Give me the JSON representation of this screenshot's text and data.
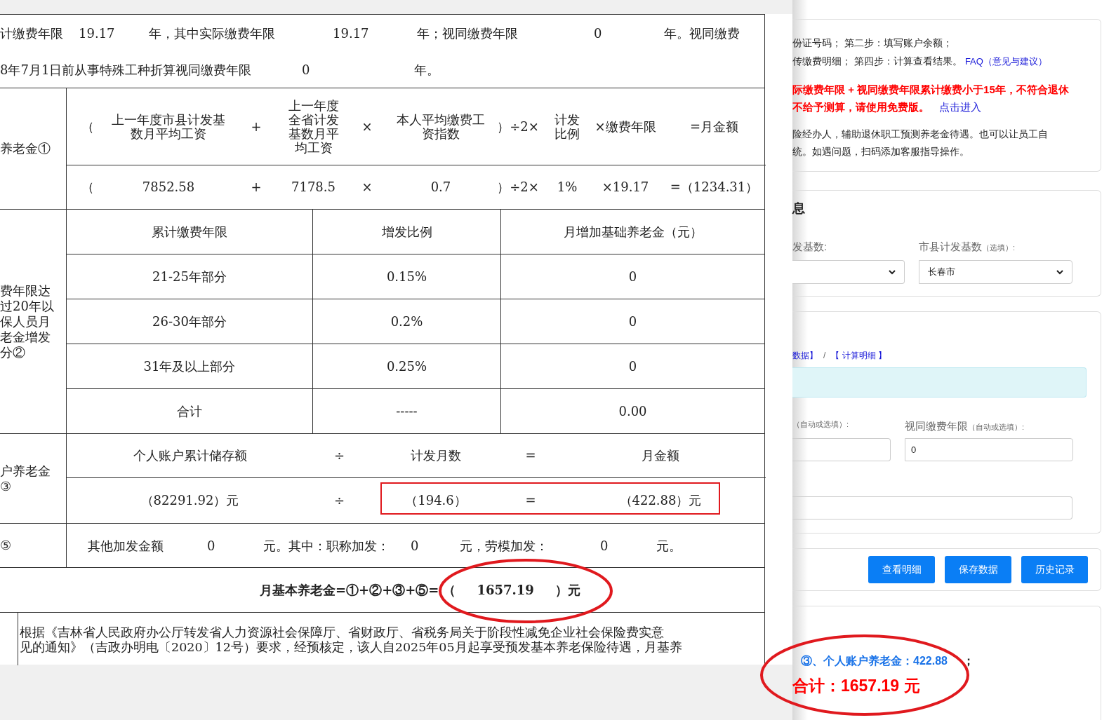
{
  "report": {
    "intro_lines": [
      [
        "计缴费年限",
        "19.17",
        "年，其中实际缴费年限",
        "19.17",
        "年；视同缴费年限",
        "0",
        "年。视同缴费"
      ],
      [
        "8年7月1日前从事特殊工种折算视同缴费年限",
        "0",
        "年。"
      ]
    ],
    "basic_pension": {
      "label": [
        "养老金①"
      ],
      "header": [
        "（",
        "上一年度市县计发基数月平均工资",
        "+",
        "上一年度全省计发基数月平均工资",
        "×",
        "本人平均缴费工资指数",
        "）÷2×",
        "计发比例",
        "×缴费年限",
        "=月金额"
      ],
      "values": [
        "（",
        "7852.58",
        "+",
        "7178.5",
        "×",
        "0.7",
        "）÷2×",
        "1%",
        "×19.17",
        "=（1234.31）"
      ]
    },
    "bonus_pension": {
      "label": [
        "费年限达",
        "过20年以",
        "保人员月",
        "老金增发",
        "分②"
      ],
      "columns": [
        "累计缴费年限",
        "增发比例",
        "月增加基础养老金（元）"
      ],
      "rows": [
        [
          "21-25年部分",
          "0.15%",
          "0"
        ],
        [
          "26-30年部分",
          "0.2%",
          "0"
        ],
        [
          "31年及以上部分",
          "0.25%",
          "0"
        ],
        [
          "合计",
          "-----",
          "0.00"
        ]
      ]
    },
    "account_pension": {
      "label": [
        "户养老金",
        "③"
      ],
      "header": [
        "个人账户累计储存额",
        "÷",
        "计发月数",
        "=",
        "月金额"
      ],
      "values": [
        "（82291.92）元",
        "÷",
        "（194.6）",
        "=",
        "（422.88）元"
      ]
    },
    "other_pension": {
      "label": [
        "⑤"
      ],
      "parts": [
        "其他加发金额",
        "0",
        "元。其中：职称加发：",
        "0",
        "元，劳模加发：",
        "0",
        "元。"
      ]
    },
    "total": {
      "formula": "月基本养老金=①+②+③+⑤=",
      "open": "（",
      "value": "1657.19",
      "close": "）元"
    },
    "notice_lines": [
      "根据《吉林省人民政府办公厅转发省人力资源社会保障厅、省财政厅、省税务局关于阶段性减免企业社会保险费实意",
      "见的通知》（吉政办明电〔2020〕12号）要求，经预核定，该人自2025年05月起享受预发基本养老保险待遇，月基养"
    ]
  },
  "steps_card": {
    "step_lines": [
      "份证号码； 第二步：填写账户余额；",
      "传缴费明细； 第四步：计算查看结果。"
    ],
    "faq_link": "FAQ（意见与建议）",
    "warning_lines": [
      "际缴费年限 + 视同缴费年限累计缴费小于15年，不符合退休",
      "不给予测算，请使用免费版。"
    ],
    "free_link": "点击进入",
    "intro_lines": [
      "险经办人，辅助退休职工预测养老金待遇。也可以让员工自",
      "统。如遇问题，扫码添加客服指导操作。"
    ]
  },
  "info_card": {
    "heading": "息",
    "fields": [
      {
        "label": "发基数:"
      },
      {
        "label": "市县计发基数",
        "hint": "（选填）:",
        "value": "长春市"
      }
    ]
  },
  "detail_card": {
    "links": [
      "数据】",
      "【 计算明细 】"
    ],
    "separator": "/",
    "fields": [
      {
        "hint": "（自动或选填）:"
      },
      {
        "label": "视同缴费年限",
        "hint": "（自动或选填）:",
        "value": "0"
      }
    ]
  },
  "buttons": [
    "查看明细",
    "保存数据",
    "历史记录"
  ],
  "result_card": {
    "account_line": "③、个人账户养老金：422.88",
    "account_end": "；",
    "total_line": "合计：1657.19 元"
  }
}
